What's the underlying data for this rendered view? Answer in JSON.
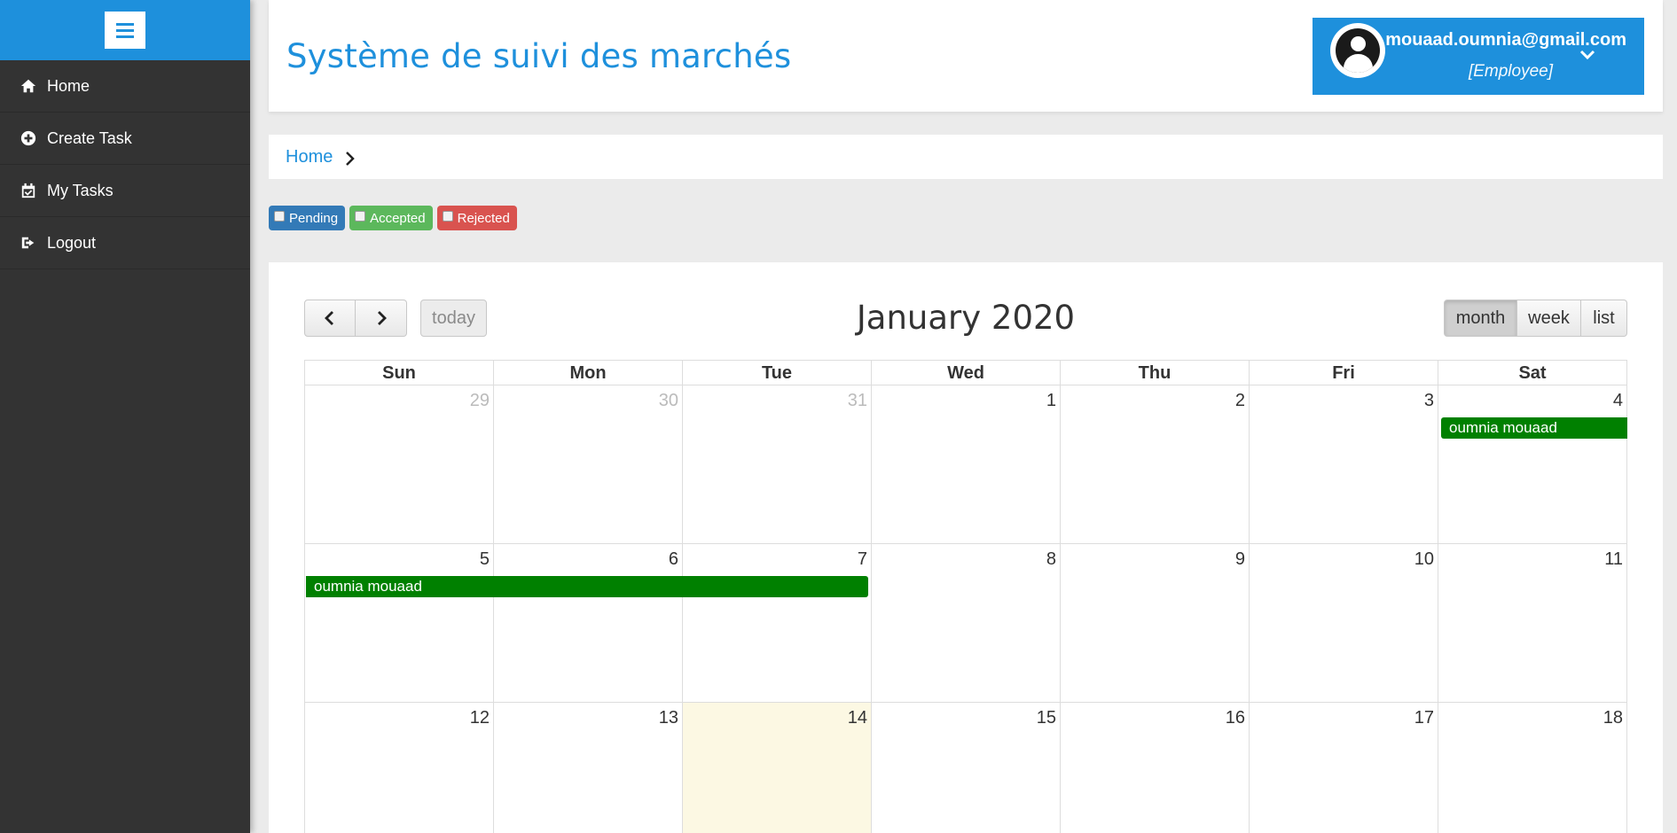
{
  "sidebar": {
    "items": [
      {
        "label": "Home",
        "icon": "home-icon"
      },
      {
        "label": "Create Task",
        "icon": "plus-circle-icon"
      },
      {
        "label": "My Tasks",
        "icon": "calendar-check-icon"
      },
      {
        "label": "Logout",
        "icon": "logout-icon"
      }
    ]
  },
  "header": {
    "title": "Système de suivi des marchés",
    "user": {
      "email": "mouaad.oumnia@gmail.com",
      "role": "[Employee]"
    }
  },
  "breadcrumb": {
    "home": "Home"
  },
  "filters": [
    {
      "label": "Pending",
      "color": "#337ab7",
      "checked": false
    },
    {
      "label": "Accepted",
      "color": "#5cb85c",
      "checked": false
    },
    {
      "label": "Rejected",
      "color": "#d9534f",
      "checked": false
    }
  ],
  "calendar": {
    "title": "January 2020",
    "today_label": "today",
    "views": {
      "month": "month",
      "week": "week",
      "list": "list"
    },
    "active_view": "month",
    "days_of_week": [
      "Sun",
      "Mon",
      "Tue",
      "Wed",
      "Thu",
      "Fri",
      "Sat"
    ],
    "weeks": [
      [
        "29",
        "30",
        "31",
        "1",
        "2",
        "3",
        "4"
      ],
      [
        "5",
        "6",
        "7",
        "8",
        "9",
        "10",
        "11"
      ],
      [
        "12",
        "13",
        "14",
        "15",
        "16",
        "17",
        "18"
      ]
    ],
    "today_date": "14",
    "events": [
      {
        "title": "oumnia mouaad",
        "color": "#008000"
      },
      {
        "title": "oumnia mouaad",
        "color": "#008000"
      }
    ]
  }
}
